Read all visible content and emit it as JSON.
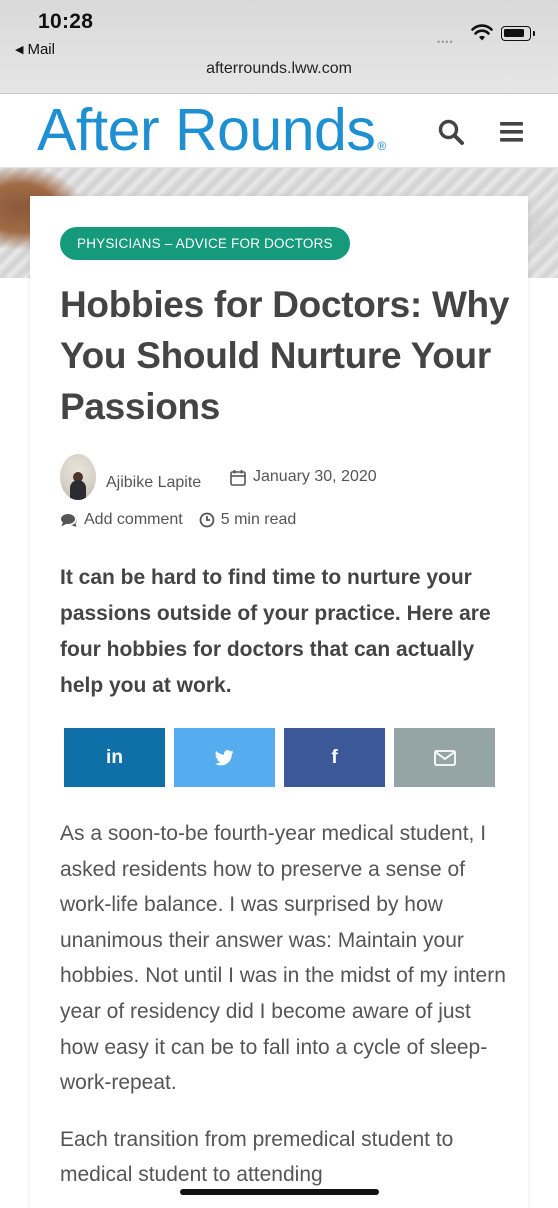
{
  "status_bar": {
    "time": "10:28",
    "back_app": "Mail",
    "url": "afterrounds.lww.com"
  },
  "site": {
    "logo": "After Rounds",
    "logo_mark": "®",
    "brand_color": "#1e8fd0",
    "search_icon": "search-icon",
    "menu_icon": "hamburger-menu-icon"
  },
  "article": {
    "category": "PHYSICIANS – ADVICE FOR DOCTORS",
    "category_color": "#159a7c",
    "title": "Hobbies for Doctors: Why You Should Nurture Your Passions",
    "author": "Ajibike Lapite",
    "date": "January 30, 2020",
    "comment_label": "Add comment",
    "read_time": "5 min read",
    "lede": "It can be hard to find time to nurture your passions outside of your practice. Here are four hobbies for doctors that can actually help you at work.",
    "share": {
      "linkedin": "in",
      "twitter_icon": "twitter-icon",
      "facebook": "f",
      "email_icon": "email-icon"
    },
    "paragraphs": [
      "As a soon-to-be fourth-year medical student, I asked residents how to preserve a sense of work-life balance. I was surprised by how unanimous their answer was: Maintain your hobbies. Not until I was in the midst of my intern year of residency did I become aware of just how easy it can be to fall into a cycle of sleep-work-repeat.",
      "Each transition from premedical student to medical student to attending"
    ]
  }
}
